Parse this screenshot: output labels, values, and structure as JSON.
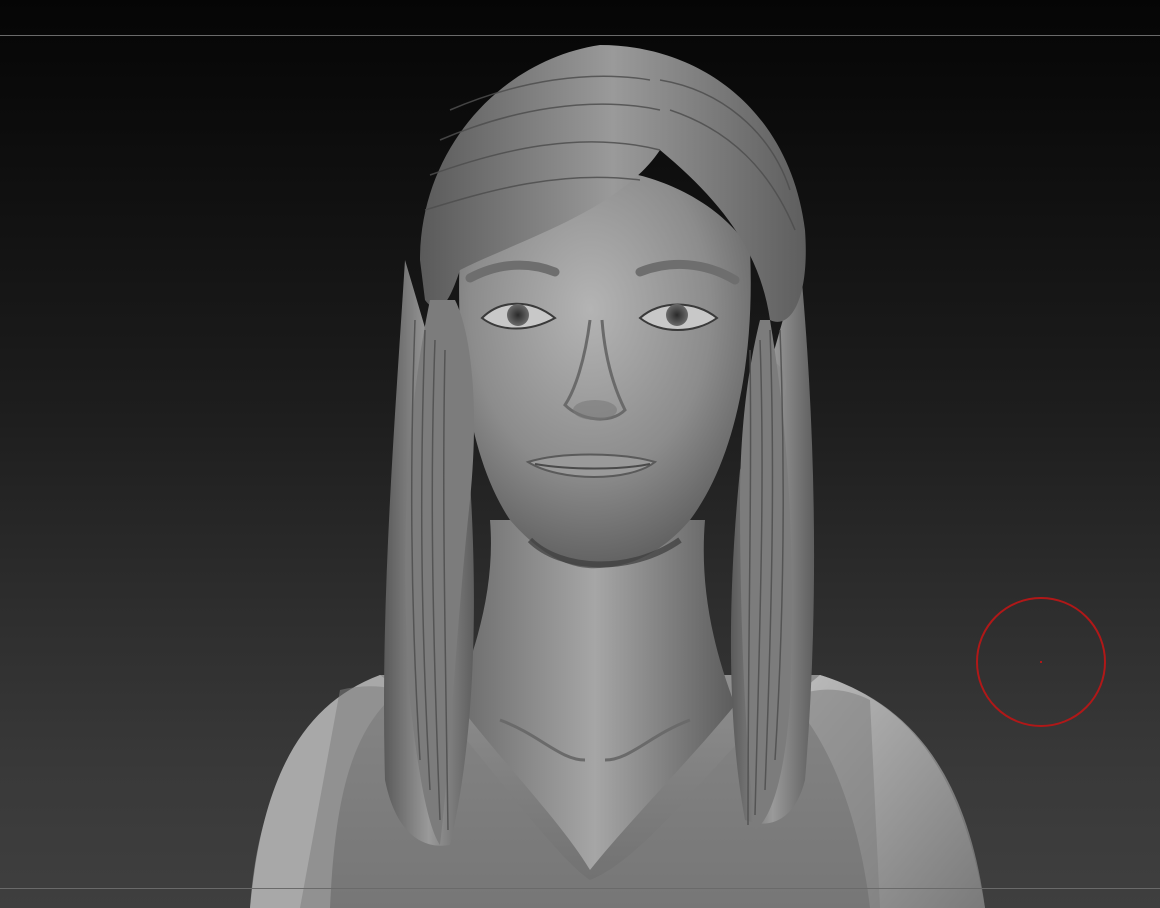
{
  "scene": {
    "subject": "",
    "colors": {
      "background_top": "#050505",
      "background_bottom": "#3f3f3f",
      "frame_line": "#6a6a6a",
      "clay": "#8a8a8a",
      "brush_cursor": "#b01818"
    }
  },
  "icons": {
    "brush_cursor": "brush-circle-icon"
  }
}
